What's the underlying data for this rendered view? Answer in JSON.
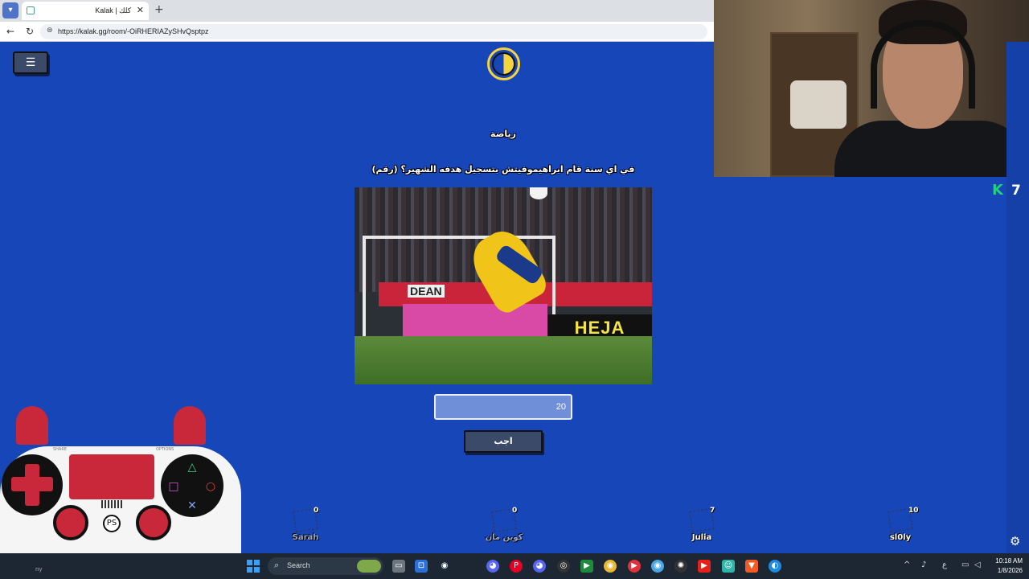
{
  "browser": {
    "tab_title": "Kalak | كلك",
    "tab_close": "✕",
    "new_tab": "+",
    "url": "https://kalak.gg/room/-OiRHERIAZySHvQsptpz"
  },
  "game": {
    "category": "رياضة",
    "question": "في اي سنة قام ابراهيموفيتش بتسجيل هدفه الشهير؟ (رقم)",
    "answer_value": "20",
    "submit_label": "اجب",
    "photo_banner_text": "HEJA SVER",
    "photo_banner_small": "DEAN",
    "k_badge": "K",
    "k_count": "7",
    "players": [
      {
        "name": "Sarah",
        "score": "0"
      },
      {
        "name": "كوين مان",
        "score": "0"
      },
      {
        "name": "Julia",
        "score": "7"
      },
      {
        "name": "sl0ly",
        "score": "10"
      }
    ]
  },
  "controller": {
    "share_label": "SHARE",
    "options_label": "OPTIONS",
    "ps_label": "PS",
    "face_buttons": {
      "triangle": "△",
      "square": "□",
      "circle": "○",
      "cross": "✕"
    }
  },
  "taskbar": {
    "search_label": "Search",
    "time": "10:18 AM",
    "date": "1/8/2026",
    "lang": "ع",
    "left_text": "ny"
  },
  "icons": {
    "menu": "hamburger-icon",
    "gear": "gear-icon",
    "search": "search-icon"
  },
  "colors": {
    "background": "#1746b8",
    "timer": "#f5d53b",
    "button": "#3a4a68",
    "input": "#6f8fd8",
    "controller_red": "#c8283a"
  }
}
